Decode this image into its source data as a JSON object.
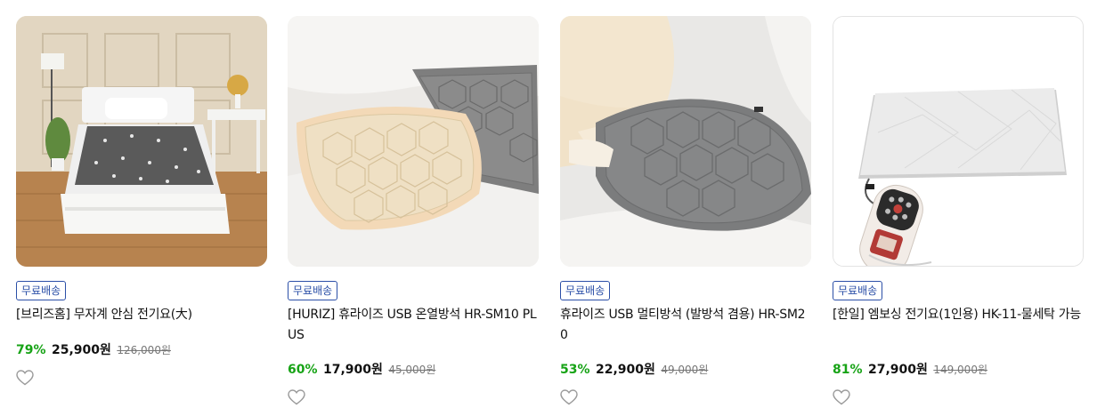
{
  "products": [
    {
      "badge": "무료배송",
      "title": "[브리즈홈] 무자계 안심 전기요(大)",
      "discount": "79%",
      "price": "25,900원",
      "original_price": "126,000원",
      "wishlist_icon": "heart-outline-icon"
    },
    {
      "badge": "무료배송",
      "title": "[HURIZ] 휴라이즈 USB 온열방석 HR-SM10 PLUS",
      "discount": "60%",
      "price": "17,900원",
      "original_price": "45,000원",
      "wishlist_icon": "heart-outline-icon"
    },
    {
      "badge": "무료배송",
      "title": "휴라이즈 USB 멀티방석 (발방석 겸용) HR-SM20",
      "discount": "53%",
      "price": "22,900원",
      "original_price": "49,000원",
      "wishlist_icon": "heart-outline-icon"
    },
    {
      "badge": "무료배송",
      "title": "[한일] 엠보싱 전기요(1인용) HK-11-물세탁 가능",
      "discount": "81%",
      "price": "27,900원",
      "original_price": "149,000원",
      "wishlist_icon": "heart-outline-icon"
    }
  ],
  "colors": {
    "discount": "#17a316",
    "badge": "#2b4fa7",
    "heart_outline": "#9a9a9a"
  }
}
